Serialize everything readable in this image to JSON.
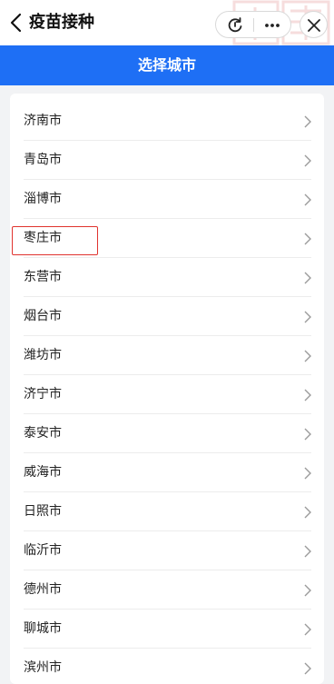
{
  "app": {
    "title": "疫苗接种"
  },
  "header": {
    "title": "选择城市"
  },
  "cities": [
    {
      "label": "济南市"
    },
    {
      "label": "青岛市"
    },
    {
      "label": "淄博市"
    },
    {
      "label": "枣庄市",
      "highlighted": true
    },
    {
      "label": "东营市"
    },
    {
      "label": "烟台市"
    },
    {
      "label": "潍坊市"
    },
    {
      "label": "济宁市"
    },
    {
      "label": "泰安市"
    },
    {
      "label": "威海市"
    },
    {
      "label": "日照市"
    },
    {
      "label": "临沂市"
    },
    {
      "label": "德州市"
    },
    {
      "label": "聊城市"
    },
    {
      "label": "滨州市"
    }
  ],
  "colors": {
    "header_bg": "#1e6ff5",
    "highlight": "#e0332e"
  },
  "icons": {
    "back": "chevron-left-icon",
    "refresh": "refresh-icon",
    "more": "more-dots-icon",
    "close": "close-icon",
    "row": "chevron-right-icon"
  }
}
